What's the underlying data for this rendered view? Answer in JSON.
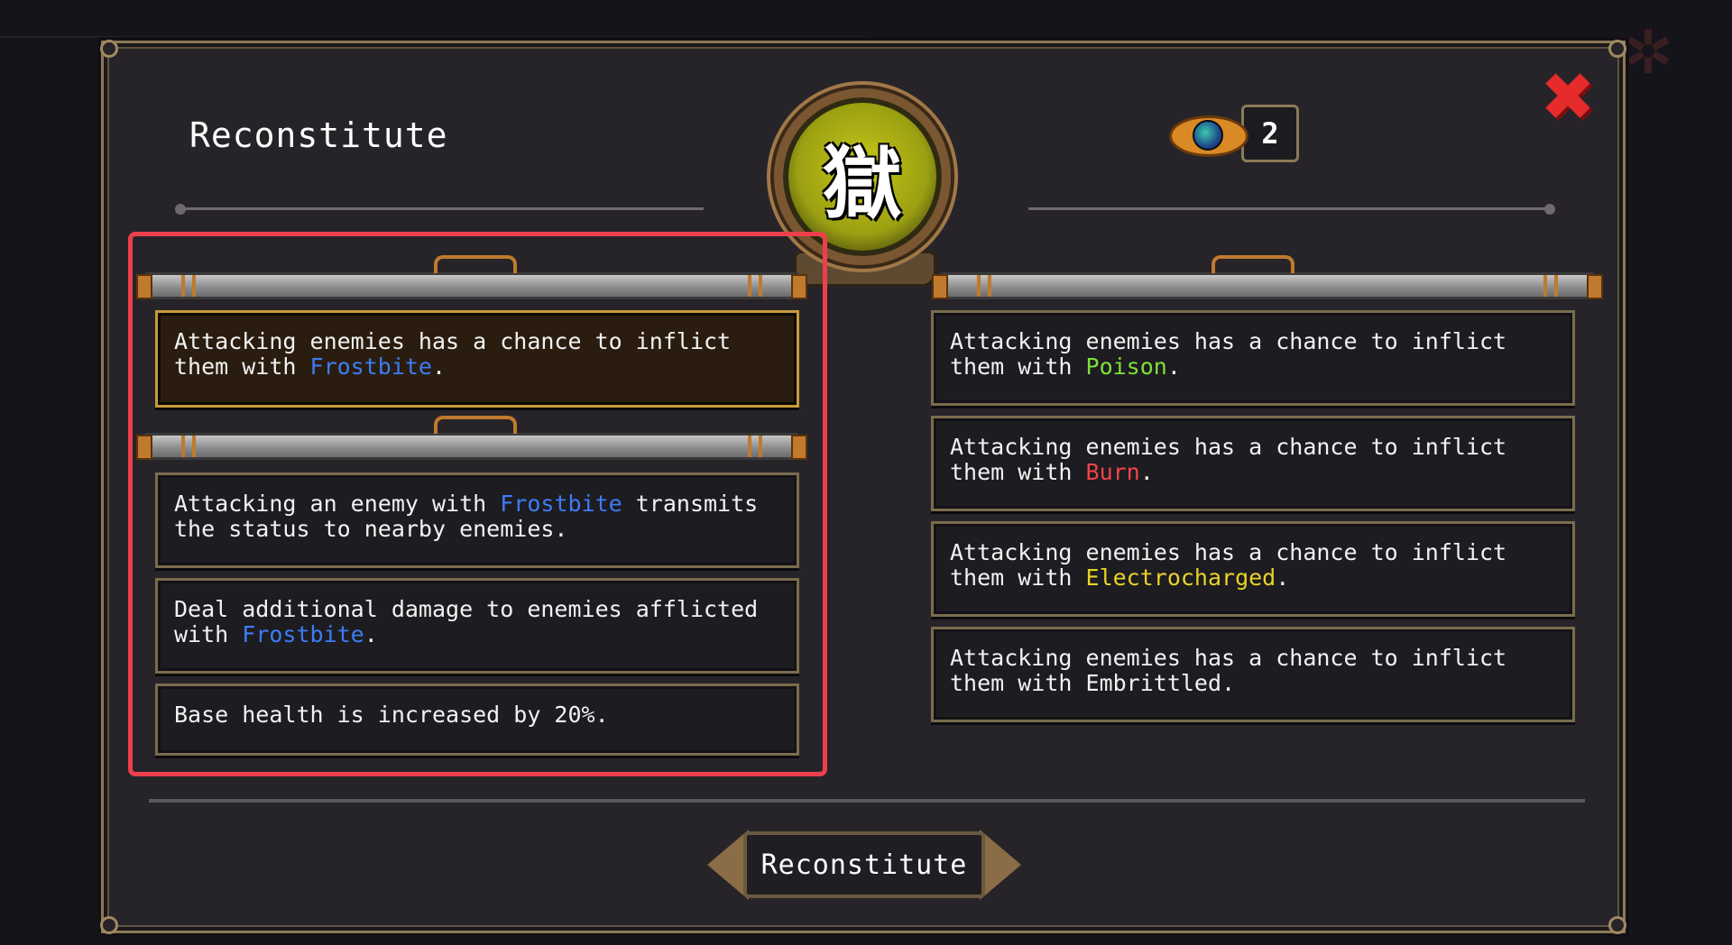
{
  "dialog": {
    "title": "Reconstitute",
    "emblem_glyph": "獄",
    "currency": {
      "icon": "eye-orb-icon",
      "count": "2"
    },
    "close_icon": "close-x-icon",
    "action_button_label": "Reconstitute"
  },
  "left_column": {
    "selected_option": {
      "prefix": "Attacking enemies has a chance to inflict\nthem with ",
      "keyword": "Frostbite",
      "suffix": "."
    },
    "upgrades": [
      {
        "prefix": "Attacking an enemy with ",
        "keyword": "Frostbite",
        "suffix": " transmits\nthe status to nearby enemies."
      },
      {
        "prefix": "Deal additional damage to enemies afflicted\nwith ",
        "keyword": "Frostbite",
        "suffix": "."
      },
      {
        "prefix": "Base health is increased by 20%.",
        "keyword": "",
        "suffix": ""
      }
    ]
  },
  "right_column": {
    "options": [
      {
        "prefix": "Attacking enemies has a chance to inflict\nthem with ",
        "keyword": "Poison",
        "suffix": "."
      },
      {
        "prefix": "Attacking enemies has a chance to inflict\nthem with ",
        "keyword": "Burn",
        "suffix": "."
      },
      {
        "prefix": "Attacking enemies has a chance to inflict\nthem with ",
        "keyword": "Electrocharged",
        "suffix": "."
      },
      {
        "prefix": "Attacking enemies has a chance to inflict\nthem with Embrittled.",
        "keyword": "",
        "suffix": ""
      }
    ]
  },
  "colors": {
    "frostbite": "#3d7cf5",
    "poison": "#7ee13b",
    "burn": "#f0444a",
    "electrocharged": "#e9d326",
    "highlight": "#ee3f4c",
    "close": "#e52b2b"
  }
}
